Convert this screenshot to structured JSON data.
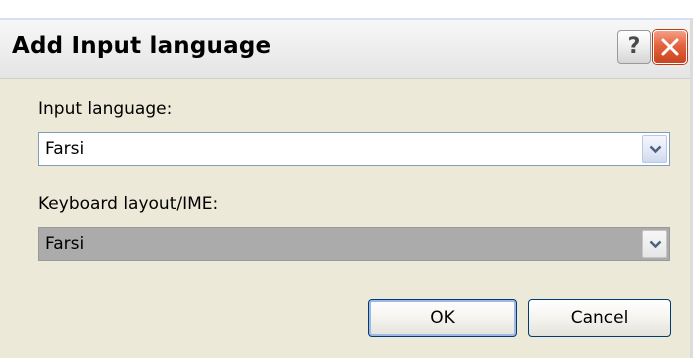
{
  "window": {
    "title": "Add Input language",
    "help_label": "?",
    "close_icon": "close-icon"
  },
  "input_language": {
    "label": "Input language:",
    "value": "Farsi"
  },
  "keyboard_layout": {
    "label": "Keyboard layout/IME:",
    "value": "Farsi",
    "disabled": true
  },
  "buttons": {
    "ok": "OK",
    "cancel": "Cancel"
  },
  "colors": {
    "dialog_background": "#ece9d8",
    "close_button": "#e4633f",
    "disabled_combo": "#ababab"
  }
}
